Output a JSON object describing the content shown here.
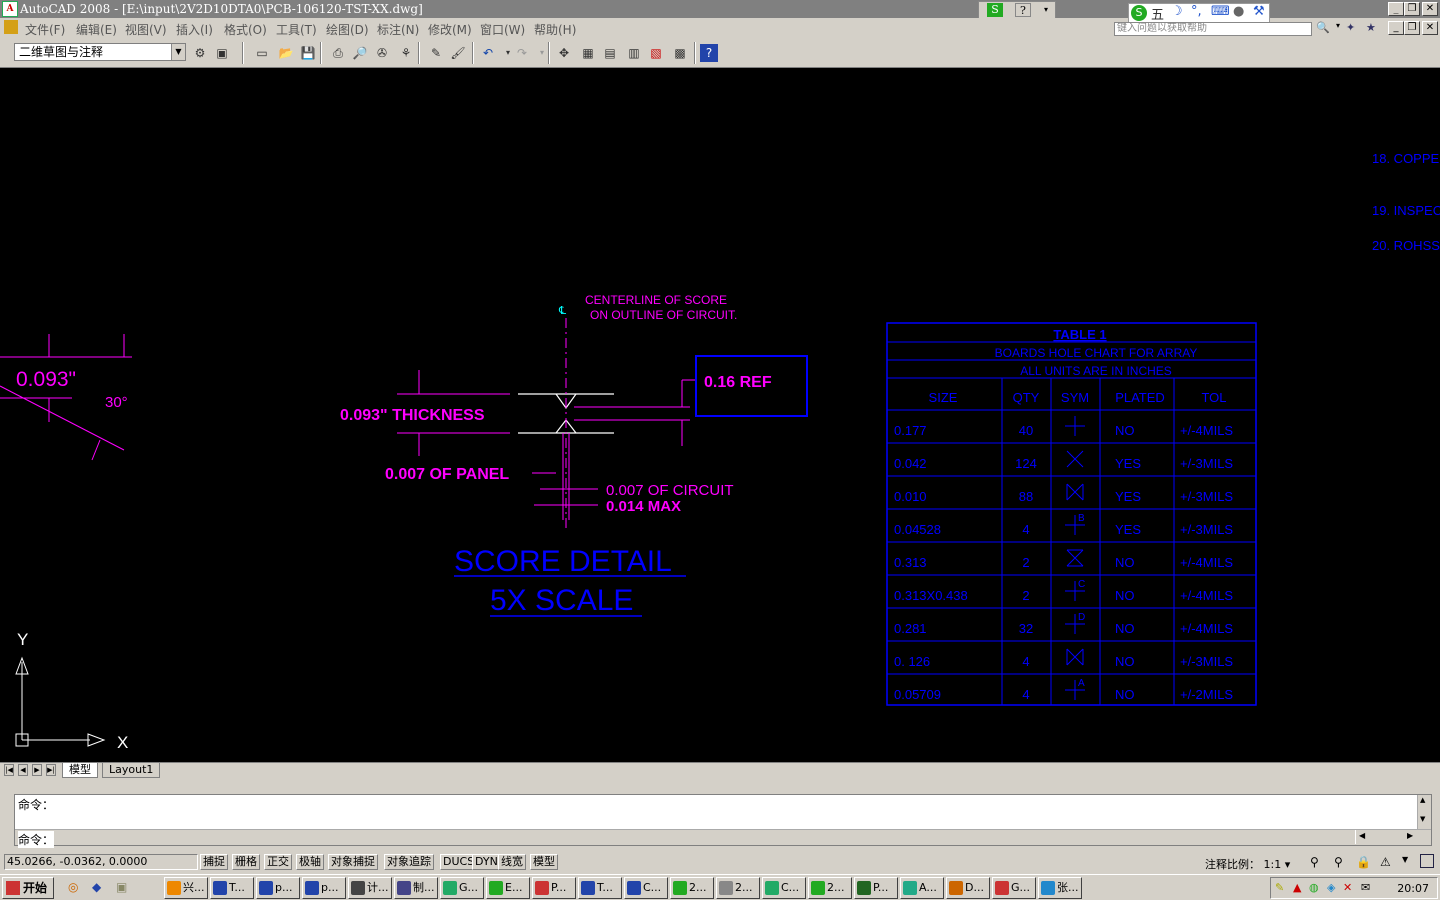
{
  "window": {
    "title": "AutoCAD 2008 - [E:\\input\\2V2D10DTA0\\PCB-106120-TST-XX.dwg]"
  },
  "menu": [
    "文件(F)",
    "编辑(E)",
    "视图(V)",
    "插入(I)",
    "格式(O)",
    "工具(T)",
    "绘图(D)",
    "标注(N)",
    "修改(M)",
    "窗口(W)",
    "帮助(H)"
  ],
  "help": {
    "placeholder": "键入问题以获取帮助"
  },
  "ime": {
    "label": "五"
  },
  "toolbar": {
    "workspace": "二维草图与注释"
  },
  "drawing": {
    "centerline_symbol": "℄",
    "centerline_note_1": "CENTERLINE OF SCORE",
    "centerline_note_2": "ON OUTLINE OF CIRCUIT.",
    "ref_box": "0.16  REF",
    "thickness": "0.093\" THICKNESS",
    "panel": "0.007 OF PANEL",
    "circuit": "0.007 OF CIRCUIT",
    "max": "0.014 MAX",
    "title_1": "SCORE DETAIL",
    "title_2": "5X SCALE",
    "left_dim": "0.093\"",
    "left_angle": "30°",
    "note_18": "18. COPPE",
    "note_19": "19. INSPEC",
    "note_20": "20. ROHSS",
    "axis_y": "Y",
    "axis_x": "X"
  },
  "table": {
    "title": "TABLE 1",
    "subtitle_1": "BOARDS HOLE CHART FOR ARRAY",
    "subtitle_2": "ALL UNITS ARE IN INCHES",
    "headers": [
      "SIZE",
      "QTY",
      "SYM",
      "PLATED",
      "TOL"
    ],
    "rows": [
      {
        "size": "0.177",
        "qty": "40",
        "sym": "plus",
        "plated": "NO",
        "tol": "+/-4MILS"
      },
      {
        "size": "0.042",
        "qty": "124",
        "sym": "x",
        "plated": "YES",
        "tol": "+/-3MILS"
      },
      {
        "size": "0.010",
        "qty": "88",
        "sym": "bowtie",
        "plated": "YES",
        "tol": "+/-3MILS"
      },
      {
        "size": "0.04528",
        "qty": "4",
        "sym": "plus-B",
        "plated": "YES",
        "tol": "+/-3MILS"
      },
      {
        "size": "0.313",
        "qty": "2",
        "sym": "hourglass",
        "plated": "NO",
        "tol": "+/-4MILS"
      },
      {
        "size": "0.313X0.438",
        "qty": "2",
        "sym": "plus-C",
        "plated": "NO",
        "tol": "+/-4MILS"
      },
      {
        "size": "0.281",
        "qty": "32",
        "sym": "plus-D",
        "plated": "NO",
        "tol": "+/-4MILS"
      },
      {
        "size": "0. 126",
        "qty": "4",
        "sym": "bowtie-x",
        "plated": "NO",
        "tol": "+/-3MILS"
      },
      {
        "size": "0.05709",
        "qty": "4",
        "sym": "plus-A",
        "plated": "NO",
        "tol": "+/-2MILS"
      }
    ],
    "sym_letters": {
      "plus-B": "B",
      "plus-C": "C",
      "plus-D": "D",
      "plus-A": "A"
    }
  },
  "tabs": {
    "model": "模型",
    "layout1": "Layout1"
  },
  "command": {
    "line1": "命令：",
    "line2": "命令："
  },
  "status": {
    "coords": "45.0266, -0.0362, 0.0000",
    "buttons": [
      "捕捉",
      "栅格",
      "正交",
      "极轴",
      "对象捕捉",
      "对象追踪",
      "DUCS",
      "DYN",
      "线宽",
      "模型"
    ],
    "annotation_scale_label": "注释比例：",
    "annotation_scale": "1:1"
  },
  "taskbar": {
    "start": "开始",
    "tasks": [
      "兴...",
      "T...",
      "p...",
      "p...",
      "计...",
      "制...",
      "G...",
      "E...",
      "P...",
      "T...",
      "C...",
      "2...",
      "2...",
      "C...",
      "2...",
      "P...",
      "A...",
      "D...",
      "G...",
      "张..."
    ],
    "time": "20:07"
  },
  "colors": {
    "magenta": "#ff00ff",
    "blue": "#0000ff",
    "white": "#ffffff",
    "cyan": "#00ffff",
    "canvas": "#000000"
  }
}
